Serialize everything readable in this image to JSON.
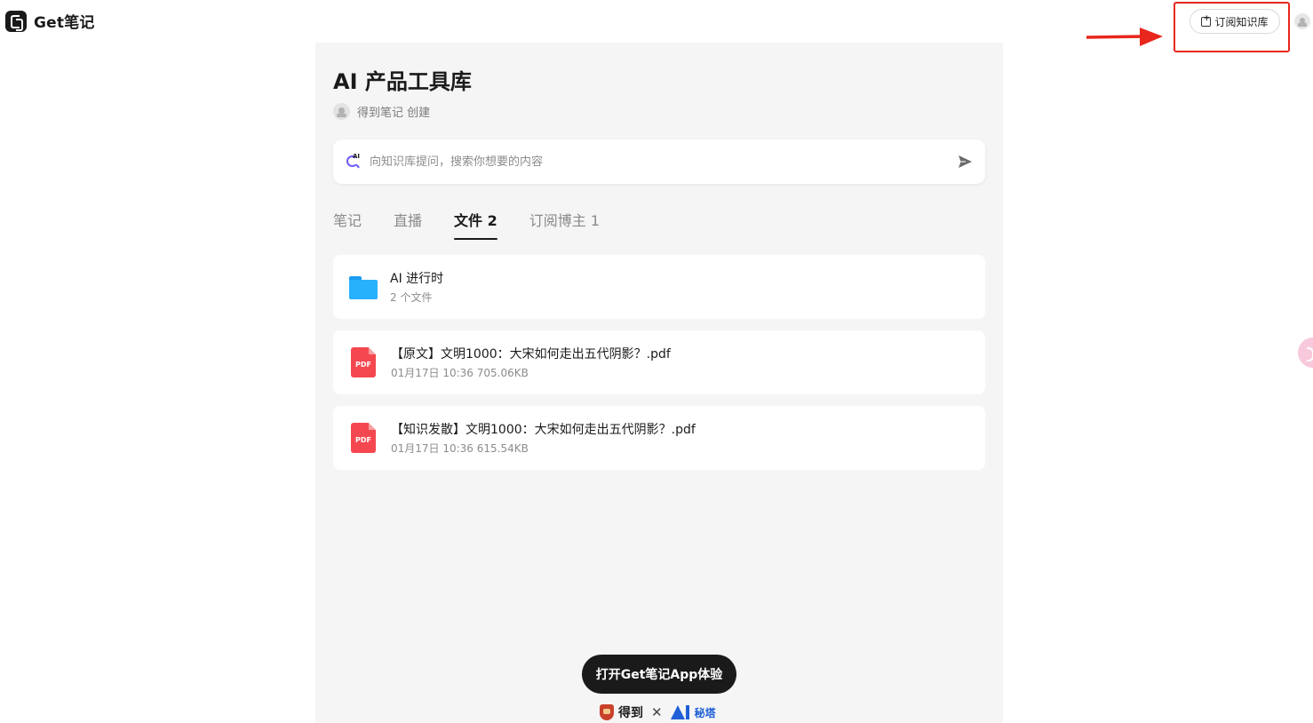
{
  "header": {
    "logo_text": "Get笔记",
    "subscribe_label": "订阅知识库"
  },
  "knowledge_base": {
    "title": "AI 产品工具库",
    "author": "得到笔记 创建"
  },
  "search": {
    "placeholder": "向知识库提问，搜索你想要的内容",
    "ai_badge": "AI"
  },
  "tabs": [
    {
      "label": "笔记",
      "active": false
    },
    {
      "label": "直播",
      "active": false
    },
    {
      "label": "文件 2",
      "active": true
    },
    {
      "label": "订阅博主 1",
      "active": false
    }
  ],
  "files": [
    {
      "type": "folder",
      "name": "AI 进行时",
      "meta": "2 个文件"
    },
    {
      "type": "pdf",
      "icon_label": "PDF",
      "name": "【原文】文明1000：大宋如何走出五代阴影？.pdf",
      "meta": "01月17日 10:36 705.06KB"
    },
    {
      "type": "pdf",
      "icon_label": "PDF",
      "name": "【知识发散】文明1000：大宋如何走出五代阴影？.pdf",
      "meta": "01月17日 10:36 615.54KB"
    }
  ],
  "footer": {
    "open_app_label": "打开Get笔记App体验",
    "brand_left": "得到",
    "separator": "✕",
    "brand_right": "秘塔"
  },
  "colors": {
    "highlight_box": "#e8261c",
    "folder": "#27b0fb",
    "pdf": "#f5474f",
    "ai_accent": "#6d5cf6",
    "panel_bg": "#f5f5f6"
  }
}
